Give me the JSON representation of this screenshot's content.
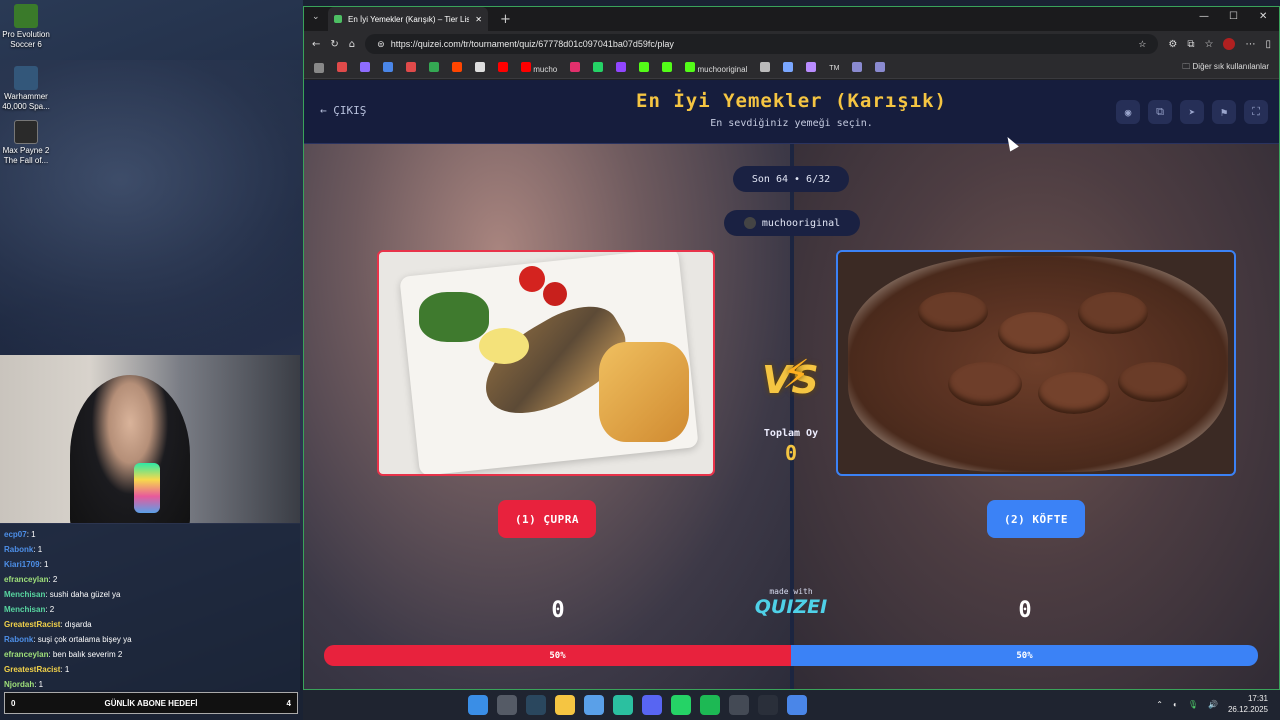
{
  "desktop": {
    "icons": [
      {
        "label": "Pro Evolution Soccer 6",
        "color": "#3a7a2a"
      },
      {
        "label": "Warhammer 40,000 Spa...",
        "color": "#33577a"
      },
      {
        "label": "Max Payne 2 The Fall of...",
        "color": "#2a2a2a"
      }
    ]
  },
  "chat": {
    "lines": [
      {
        "user": "ecp07",
        "text": ": 1",
        "color": "#4d8fe8"
      },
      {
        "user": "Rabonk",
        "text": ": 1",
        "color": "#4d8fe8"
      },
      {
        "user": "Kiari1709",
        "text": ": 1",
        "color": "#4d8fe8"
      },
      {
        "user": "efranceylan",
        "text": ": 2",
        "color": "#9fe07a"
      },
      {
        "user": "Menchisan",
        "text": ": sushi daha güzel ya",
        "color": "#58d6a0"
      },
      {
        "user": "Menchisan",
        "text": ": 2",
        "color": "#58d6a0"
      },
      {
        "user": "GreatestRacist",
        "text": ": dışarda",
        "color": "#f2d24a"
      },
      {
        "user": "Rabonk",
        "text": ": suşi çok ortalama bişey ya",
        "color": "#4d8fe8"
      },
      {
        "user": "efranceylan",
        "text": ": ben balık severim 2",
        "color": "#9fe07a"
      },
      {
        "user": "GreatestRacist",
        "text": ": 1",
        "color": "#f2d24a"
      },
      {
        "user": "Njordah",
        "text": ": 1",
        "color": "#9fe07a"
      }
    ],
    "goal_count": "0",
    "goal_label": "GÜNLİK ABONE HEDEFİ",
    "goal_target": "4"
  },
  "browser": {
    "tab_title": "En İyi Yemekler (Karışık) – Tier List",
    "url": "https://quizei.com/tr/tournament/quiz/67778d01c097041ba07d59fc/play",
    "bookmarks": [
      {
        "label": "",
        "color": "#e04a4a"
      },
      {
        "label": "",
        "color": "#8e6cff"
      },
      {
        "label": "",
        "color": "#4a86e8"
      },
      {
        "label": "",
        "color": "#e04a4a"
      },
      {
        "label": "",
        "color": "#34a853"
      },
      {
        "label": "",
        "color": "#ff4500"
      },
      {
        "label": "",
        "color": "#dddddd"
      },
      {
        "label": "",
        "color": "#ff0000"
      },
      {
        "label": "mucho",
        "color": "#ff0000"
      },
      {
        "label": "",
        "color": "#e1306c"
      },
      {
        "label": "",
        "color": "#25d366"
      },
      {
        "label": "",
        "color": "#9146ff"
      },
      {
        "label": "",
        "color": "#53fc18"
      },
      {
        "label": "",
        "color": "#53fc18"
      },
      {
        "label": "muchooriginal",
        "color": "#53fc18"
      },
      {
        "label": "",
        "color": "#bbbbbb"
      },
      {
        "label": "",
        "color": "#7aa7ff"
      },
      {
        "label": "",
        "color": "#b98cff"
      },
      {
        "label": "TM",
        "color": "#444444"
      },
      {
        "label": "",
        "color": "#8a8ad0"
      },
      {
        "label": "",
        "color": "#8a8ad0"
      }
    ],
    "other_bookmarks": "Diğer sık kullanılanlar"
  },
  "page": {
    "exit_label": "ÇIKIŞ",
    "title": "En İyi Yemekler (Karışık)",
    "subtitle": "En sevdiğiniz yemeği seçin.",
    "round_label": "Son 64 • 6/32",
    "creator": "muchooriginal",
    "left": {
      "button_label": "(1) ÇUPRA",
      "score": "0",
      "percent": "50%"
    },
    "right": {
      "button_label": "(2) KÖFTE",
      "score": "0",
      "percent": "50%"
    },
    "total_label": "Toplam Oy",
    "total_value": "0",
    "made_with": "made with",
    "brand": "QUIZEI",
    "vs": "VS",
    "progress_left_fraction": 0.5,
    "accent_left": "#e8223d",
    "accent_right": "#3b82f6",
    "title_color": "#f5c542"
  },
  "taskbar": {
    "apps": [
      {
        "name": "windows-start",
        "color": "#3a8ee6"
      },
      {
        "name": "search",
        "color": "#555b66"
      },
      {
        "name": "steam",
        "color": "#2a475e"
      },
      {
        "name": "file-explorer",
        "color": "#f5c542"
      },
      {
        "name": "store",
        "color": "#5aa0e8"
      },
      {
        "name": "edge",
        "color": "#2bc0a0"
      },
      {
        "name": "discord",
        "color": "#5865f2"
      },
      {
        "name": "whatsapp",
        "color": "#25d366"
      },
      {
        "name": "spotify",
        "color": "#1db954"
      },
      {
        "name": "obs",
        "color": "#444a55"
      },
      {
        "name": "app-circle",
        "color": "#2a2f3a"
      },
      {
        "name": "app-blue",
        "color": "#4a86e8"
      }
    ],
    "time": "17:31",
    "date": "26.12.2025"
  }
}
